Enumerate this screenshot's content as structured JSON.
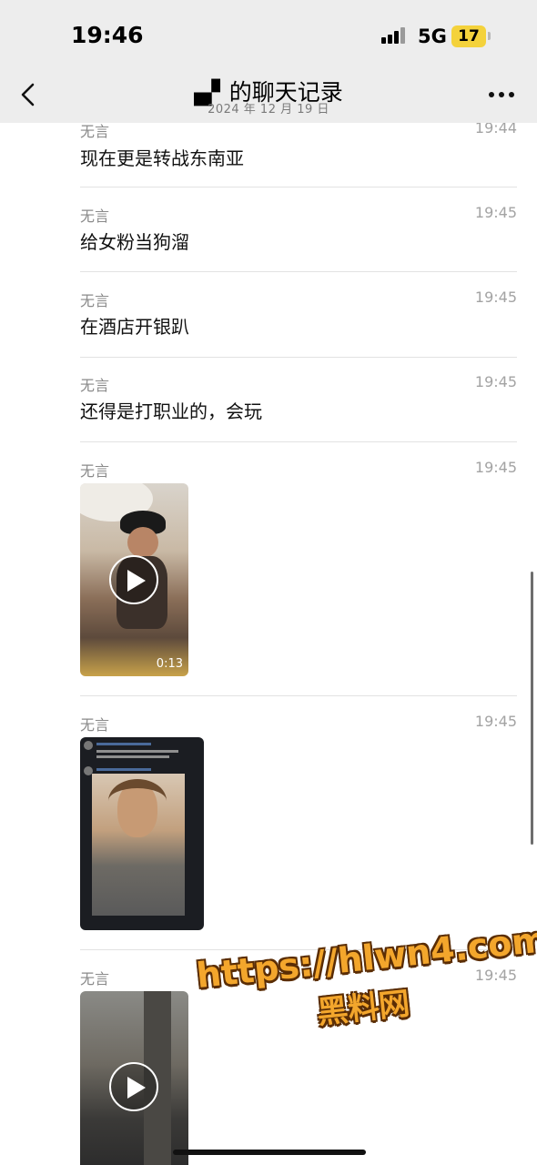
{
  "status_bar": {
    "time": "19:46",
    "network": "5G",
    "battery": "17"
  },
  "nav": {
    "title": "▄▘的聊天记录",
    "subtitle": "2024 年 12 月 19 日"
  },
  "messages": [
    {
      "sender": "无言",
      "time": "19:44",
      "text": "现在更是转战东南亚"
    },
    {
      "sender": "无言",
      "time": "19:45",
      "text": "给女粉当狗溜"
    },
    {
      "sender": "无言",
      "time": "19:45",
      "text": "在酒店开银趴"
    },
    {
      "sender": "无言",
      "time": "19:45",
      "text": "还得是打职业的，会玩"
    },
    {
      "sender": "无言",
      "time": "19:45",
      "video_duration": "0:13"
    },
    {
      "sender": "无言",
      "time": "19:45"
    },
    {
      "sender": "无言",
      "time": "19:45"
    }
  ],
  "watermark": {
    "url": "https://hlwn4.com",
    "name": "黑料网"
  },
  "icons": {
    "back": "chevron-left-icon",
    "more": "more-dots-icon",
    "play": "play-icon"
  }
}
